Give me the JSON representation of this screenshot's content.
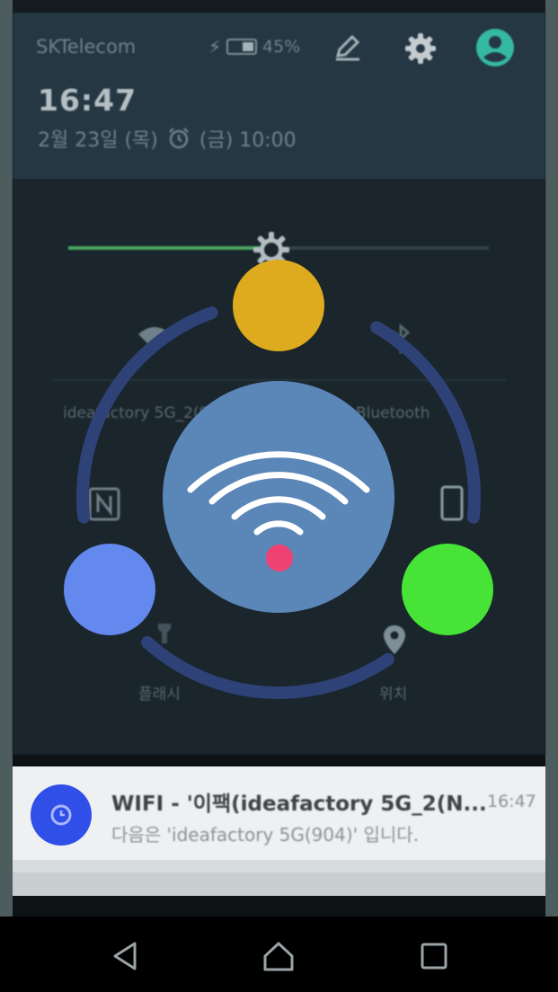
{
  "status_bar": {
    "carrier": "SKTelecom",
    "battery_percent": "45%",
    "battery_level": 0.45
  },
  "header": {
    "time": "16:47",
    "date": "2월 23일 (목)",
    "alarm": "(금) 10:00"
  },
  "quick_settings": {
    "brightness_level": 0.47,
    "wifi_ssid": "ideafactory 5G_2(904)",
    "bluetooth_label": "Bluetooth",
    "flash_label": "플래시",
    "location_label": "위치"
  },
  "notification": {
    "title": "WIFI - '이팩(ideafactory 5G_2(N...",
    "body": "다음은 'ideafactory 5G(904)' 입니다.",
    "time": "16:47"
  },
  "overlay": {
    "center_color": "#5b86b8",
    "top_node_color": "#deab1e",
    "left_node_color": "#6388ee",
    "right_node_color": "#47e337",
    "ring_color": "#2f4277",
    "dot_color": "#ef4272"
  }
}
